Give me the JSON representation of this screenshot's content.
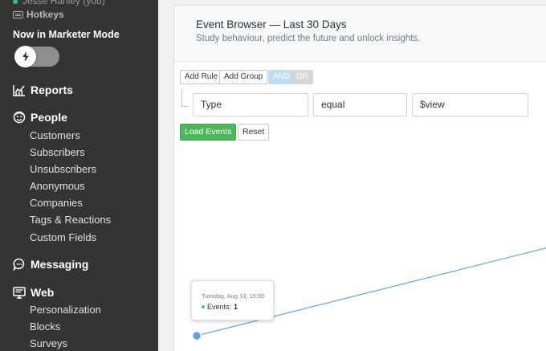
{
  "sidebar": {
    "user": "Jesse Hanley (you)",
    "hotkeys": "Hotkeys",
    "mode_label": "Now in Marketer Mode",
    "sections": {
      "reports": "Reports",
      "people": "People",
      "messaging": "Messaging",
      "web": "Web"
    },
    "people_items": [
      "Customers",
      "Subscribers",
      "Unsubscribers",
      "Anonymous",
      "Companies",
      "Tags & Reactions",
      "Custom Fields"
    ],
    "web_items": [
      "Personalization",
      "Blocks",
      "Surveys"
    ]
  },
  "panel": {
    "title": "Event Browser — Last 30 Days",
    "subtitle": "Study behaviour, predict the future and unlock insights."
  },
  "query": {
    "add_rule": "Add Rule",
    "add_group": "Add Group",
    "and": "AND",
    "or": "OR",
    "field": "Type",
    "operator": "equal",
    "value": "$view",
    "load_events": "Load Events",
    "reset": "Reset"
  },
  "chart_data": {
    "type": "line",
    "x": [
      "Tuesday, Aug 13, 15:00"
    ],
    "series": [
      {
        "values": [
          1
        ]
      }
    ],
    "tooltip": {
      "date": "Tuesday, Aug 13, 15:00",
      "label": "Events:",
      "value": "1"
    },
    "color": "#5aa8e0"
  }
}
